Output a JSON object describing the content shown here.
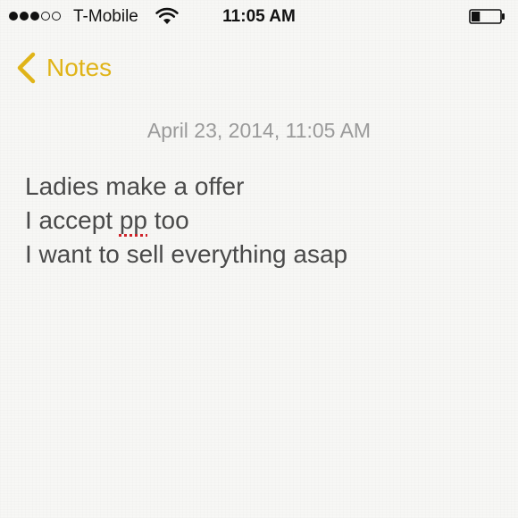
{
  "status_bar": {
    "signal": [
      "filled",
      "filled",
      "filled",
      "empty",
      "empty"
    ],
    "carrier": "T-Mobile",
    "time": "11:05 AM",
    "battery_level": 0.3
  },
  "nav": {
    "back_label": "Notes",
    "accent_color": "#e0b418"
  },
  "note": {
    "date": "April 23, 2014, 11:05 AM",
    "lines": [
      {
        "before": "Ladies make a offer",
        "misspelled": "",
        "after": ""
      },
      {
        "before": "I accept ",
        "misspelled": "pp",
        "after": " too"
      },
      {
        "before": "I want to sell everything asap",
        "misspelled": "",
        "after": ""
      }
    ]
  },
  "colors": {
    "spellcheck_underline": "#d0232a",
    "date_text": "#9a9a9a",
    "body_text": "#4a4a4a"
  },
  "icons": [
    "wifi-icon",
    "battery-icon",
    "back-chevron-icon"
  ]
}
